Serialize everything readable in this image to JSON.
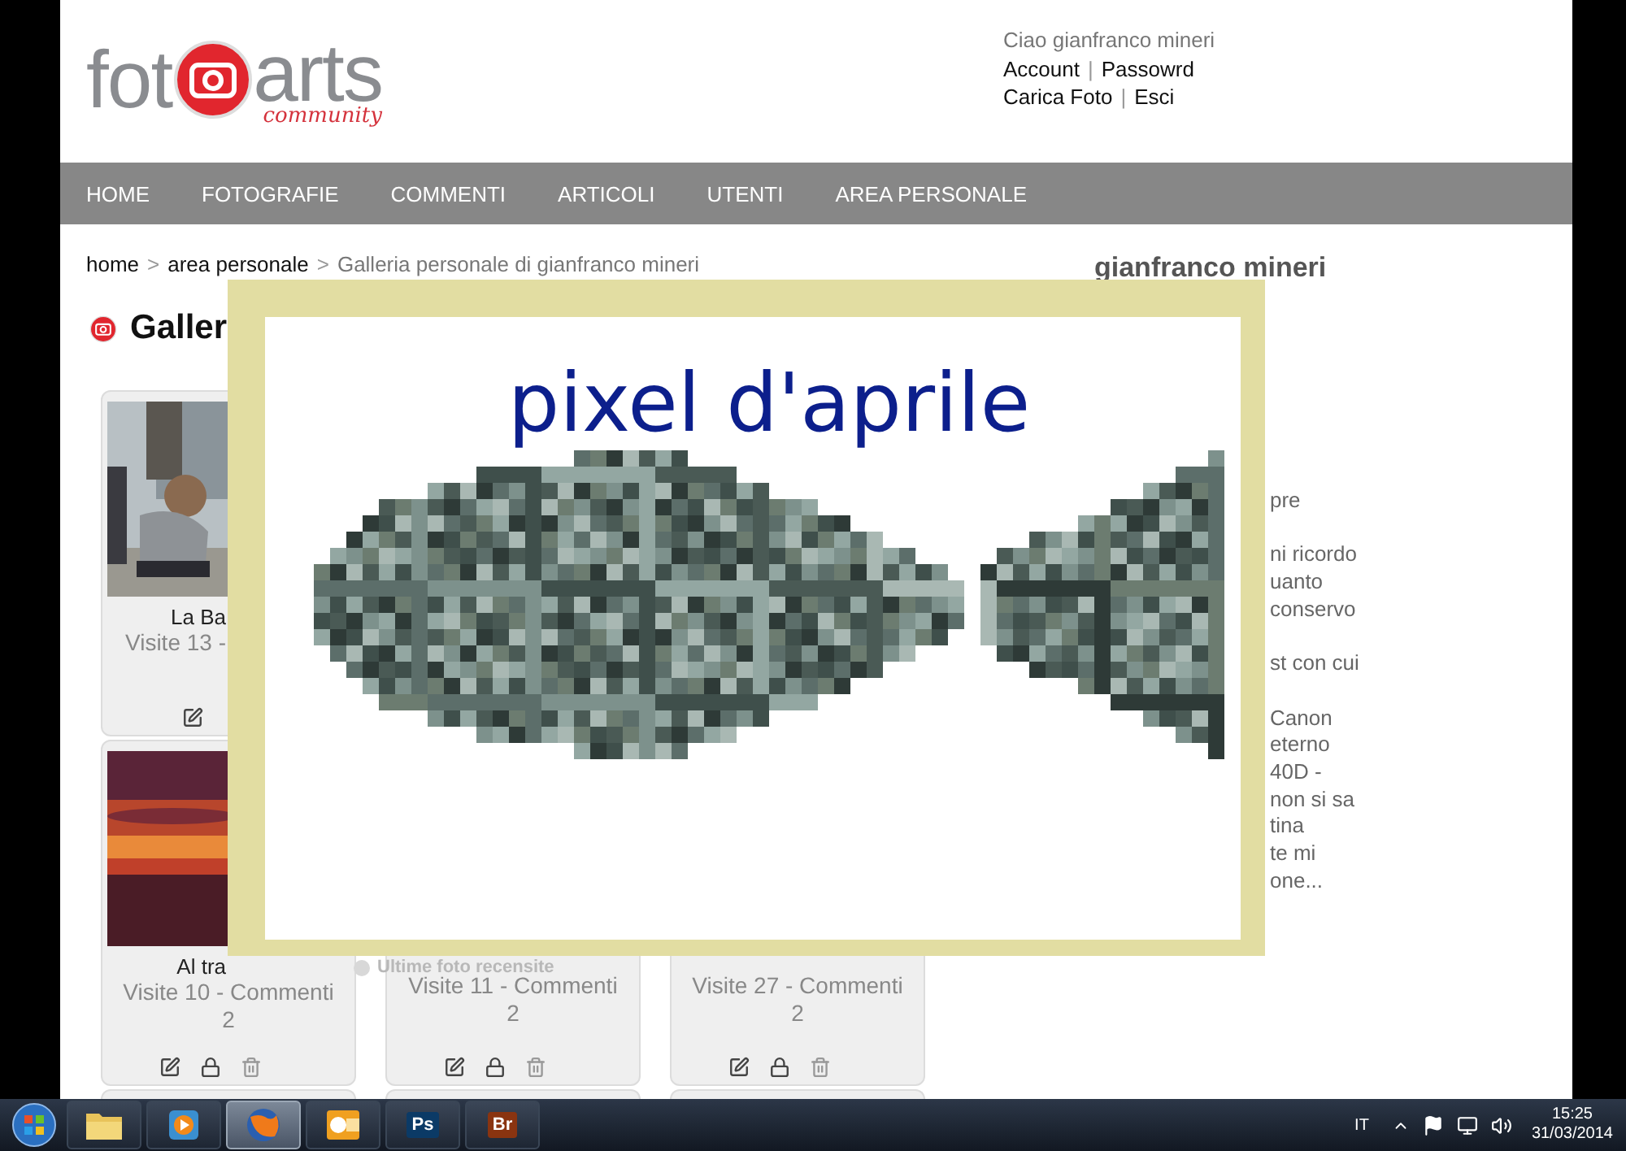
{
  "logo": {
    "left": "fot",
    "right": "arts",
    "tagline": "community"
  },
  "user_panel": {
    "greeting": "Ciao gianfranco mineri",
    "rows": [
      {
        "first": "Account",
        "separator": "|",
        "second": "Passowrd"
      },
      {
        "first": "Carica Foto",
        "separator": "|",
        "second": "Esci"
      }
    ]
  },
  "nav": [
    "HOME",
    "FOTOGRAFIE",
    "COMMENTI",
    "ARTICOLI",
    "UTENTI",
    "AREA PERSONALE"
  ],
  "breadcrumb": [
    {
      "kind": "link",
      "text": "home"
    },
    {
      "kind": "sep",
      "text": ">"
    },
    {
      "kind": "link",
      "text": "area personale"
    },
    {
      "kind": "sep",
      "text": ">"
    },
    {
      "kind": "current",
      "text": "Galleria personale di gianfranco mineri"
    }
  ],
  "heading": "Galler",
  "gallery": {
    "rows": [
      [
        {
          "kind": "clipped",
          "lines": [
            {
              "kind": "title",
              "text": "La Ba",
              "cut": true
            },
            {
              "kind": "stat",
              "text": "Visite 13 -",
              "cut": true
            }
          ]
        }
      ],
      [
        {
          "kind": "full",
          "lines": [
            {
              "kind": "title",
              "text": "Al tra",
              "cut": true
            },
            {
              "kind": "stat",
              "text": "Visite 10 - Commenti",
              "cut": false
            },
            {
              "kind": "stat",
              "text": "2",
              "cut": false
            }
          ]
        },
        {
          "kind": "covered",
          "lines": [
            {
              "kind": "stat",
              "text": "Visite 11 - Commenti"
            },
            {
              "kind": "stat",
              "text": "2"
            }
          ]
        },
        {
          "kind": "covered",
          "lines": [
            {
              "kind": "stat",
              "text": "Visite 27 - Commenti"
            },
            {
              "kind": "stat",
              "text": "2"
            }
          ]
        }
      ],
      [
        {
          "kind": "cut_off"
        },
        {
          "kind": "cut_off"
        },
        {
          "kind": "cut_off"
        }
      ]
    ]
  },
  "recent_heading": "Ultime foto recensite",
  "profile": {
    "name": "gianfranco mineri",
    "bio_fragments": [
      [
        "pre"
      ],
      [
        "ni ricordo",
        "uanto",
        "conservo"
      ],
      [
        "st con cui"
      ],
      [
        "Canon",
        "eterno",
        "40D -",
        "non si sa",
        "tina",
        "te mi",
        "one..."
      ]
    ]
  },
  "overlay": {
    "caption": "pixel d'aprile"
  },
  "taskbar": {
    "apps": [
      {
        "kind": "folder",
        "selected": false
      },
      {
        "kind": "media",
        "selected": false
      },
      {
        "kind": "browser",
        "selected": true
      },
      {
        "kind": "mail",
        "selected": false
      },
      {
        "kind": "lettered",
        "label": "Ps",
        "color": "#0b3a66",
        "selected": false
      },
      {
        "kind": "lettered",
        "label": "Br",
        "color": "#8a3410",
        "selected": false
      }
    ],
    "language": "IT",
    "time": "15:25",
    "date": "31/03/2014"
  }
}
